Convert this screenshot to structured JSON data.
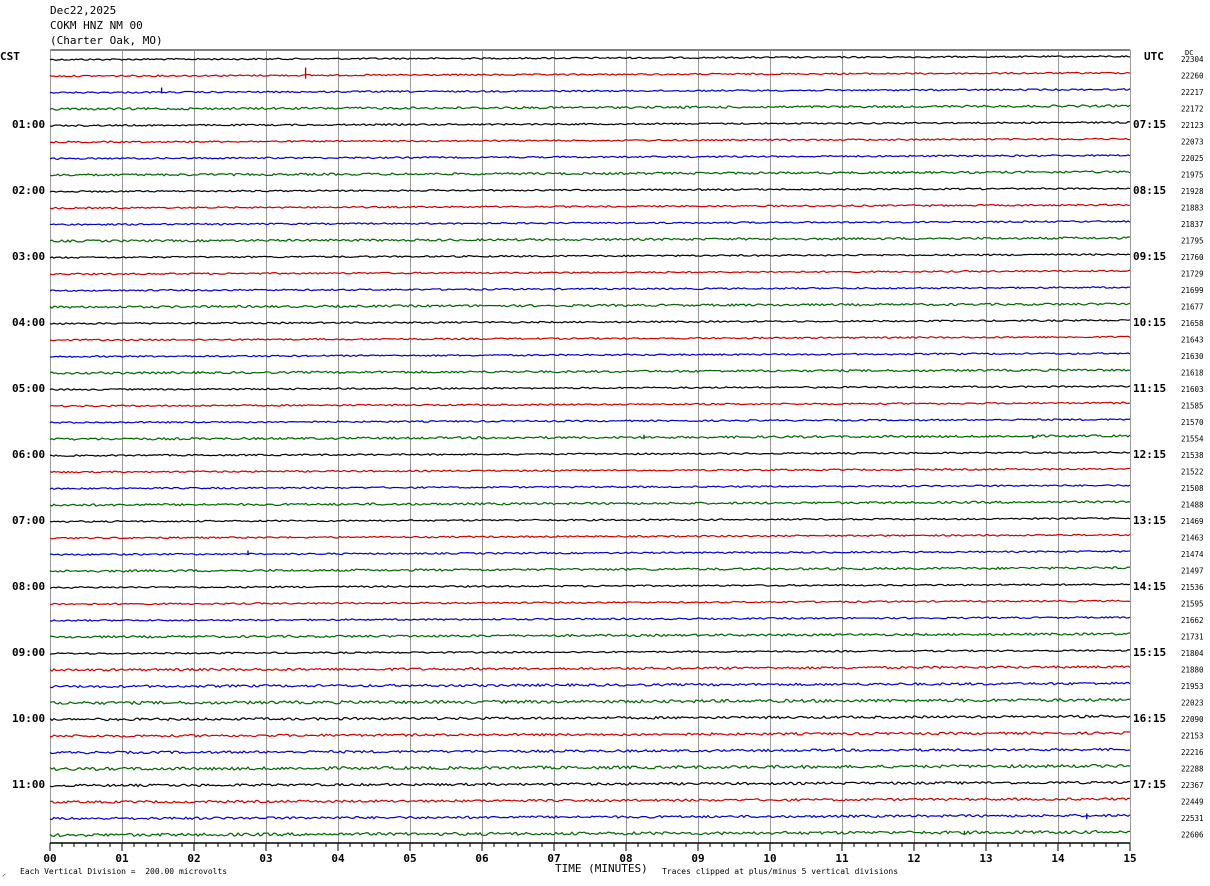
{
  "header": {
    "date": "Dec22,2025",
    "station": "COKM HNZ NM 00",
    "location": "(Charter Oak, MO)"
  },
  "left_tz": "CST",
  "right_tz": "UTC",
  "dc_label": "DC",
  "footer": {
    "left_mark": "⸝",
    "scale": "Each Vertical Division =  200.00 microvolts",
    "clip": "Traces clipped at plus/minus 5 vertical divisions"
  },
  "colors": {
    "cycle": [
      "#000000",
      "#cc0000",
      "#0000cc",
      "#006600"
    ],
    "grid": "#999999"
  },
  "chart_data": {
    "type": "line",
    "title": "COKM HNZ NM 00 (Charter Oak, MO) Dec22,2025",
    "xlabel": "TIME (MINUTES)",
    "x_ticks": [
      "00",
      "01",
      "02",
      "03",
      "04",
      "05",
      "06",
      "07",
      "08",
      "09",
      "10",
      "11",
      "12",
      "13",
      "14",
      "15"
    ],
    "xlim": [
      0,
      15
    ],
    "left_hour_labels": [
      {
        "row": 4,
        "label": "01:00"
      },
      {
        "row": 8,
        "label": "02:00"
      },
      {
        "row": 12,
        "label": "03:00"
      },
      {
        "row": 16,
        "label": "04:00"
      },
      {
        "row": 20,
        "label": "05:00"
      },
      {
        "row": 24,
        "label": "06:00"
      },
      {
        "row": 28,
        "label": "07:00"
      },
      {
        "row": 32,
        "label": "08:00"
      },
      {
        "row": 36,
        "label": "09:00"
      },
      {
        "row": 40,
        "label": "10:00"
      },
      {
        "row": 44,
        "label": "11:00"
      }
    ],
    "right_hour_labels": [
      {
        "row": 4,
        "label": "07:15"
      },
      {
        "row": 8,
        "label": "08:15"
      },
      {
        "row": 12,
        "label": "09:15"
      },
      {
        "row": 16,
        "label": "10:15"
      },
      {
        "row": 20,
        "label": "11:15"
      },
      {
        "row": 24,
        "label": "12:15"
      },
      {
        "row": 28,
        "label": "13:15"
      },
      {
        "row": 32,
        "label": "14:15"
      },
      {
        "row": 36,
        "label": "15:15"
      },
      {
        "row": 40,
        "label": "16:15"
      },
      {
        "row": 44,
        "label": "17:15"
      }
    ],
    "dc_offsets": [
      "22304",
      "22260",
      "22217",
      "22172",
      "22123",
      "22073",
      "22025",
      "21975",
      "21928",
      "21883",
      "21837",
      "21795",
      "21760",
      "21729",
      "21699",
      "21677",
      "21658",
      "21643",
      "21630",
      "21618",
      "21603",
      "21585",
      "21570",
      "21554",
      "21538",
      "21522",
      "21508",
      "21488",
      "21469",
      "21463",
      "21474",
      "21497",
      "21536",
      "21595",
      "21662",
      "21731",
      "21804",
      "21880",
      "21953",
      "22023",
      "22090",
      "22153",
      "22216",
      "22288",
      "22367",
      "22449",
      "22531",
      "22606"
    ],
    "events": [
      {
        "row": 1,
        "minute": 3.55,
        "amplitude": 1.0
      },
      {
        "row": 2,
        "minute": 1.55,
        "amplitude": 0.5
      },
      {
        "row": 23,
        "minute": 8.25,
        "amplitude": 0.4
      },
      {
        "row": 23,
        "minute": 13.65,
        "amplitude": 0.3
      },
      {
        "row": 30,
        "minute": 2.75,
        "amplitude": 0.35
      },
      {
        "row": 46,
        "minute": 14.4,
        "amplitude": 0.5
      },
      {
        "row": 47,
        "minute": 12.7,
        "amplitude": 0.4
      }
    ]
  }
}
